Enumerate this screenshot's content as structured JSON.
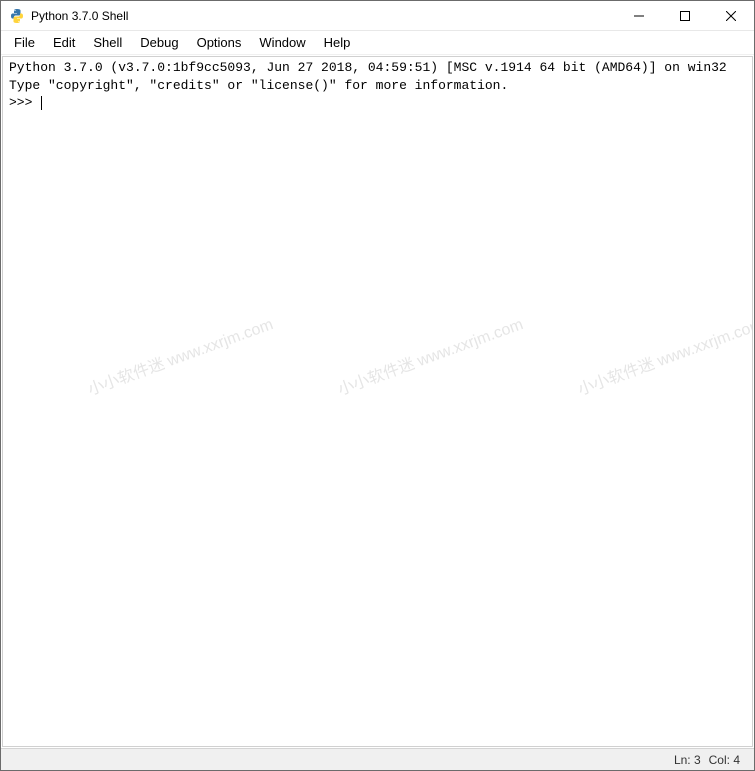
{
  "window": {
    "title": "Python 3.7.0 Shell"
  },
  "menubar": {
    "items": [
      "File",
      "Edit",
      "Shell",
      "Debug",
      "Options",
      "Window",
      "Help"
    ]
  },
  "shell": {
    "banner_line1": "Python 3.7.0 (v3.7.0:1bf9cc5093, Jun 27 2018, 04:59:51) [MSC v.1914 64 bit (AMD64)] on win32",
    "banner_line2": "Type \"copyright\", \"credits\" or \"license()\" for more information.",
    "prompt": ">>> "
  },
  "statusbar": {
    "line_label": "Ln: 3",
    "col_label": "Col: 4"
  },
  "watermark": {
    "text": "小小软件迷 www.xxrjm.com"
  }
}
